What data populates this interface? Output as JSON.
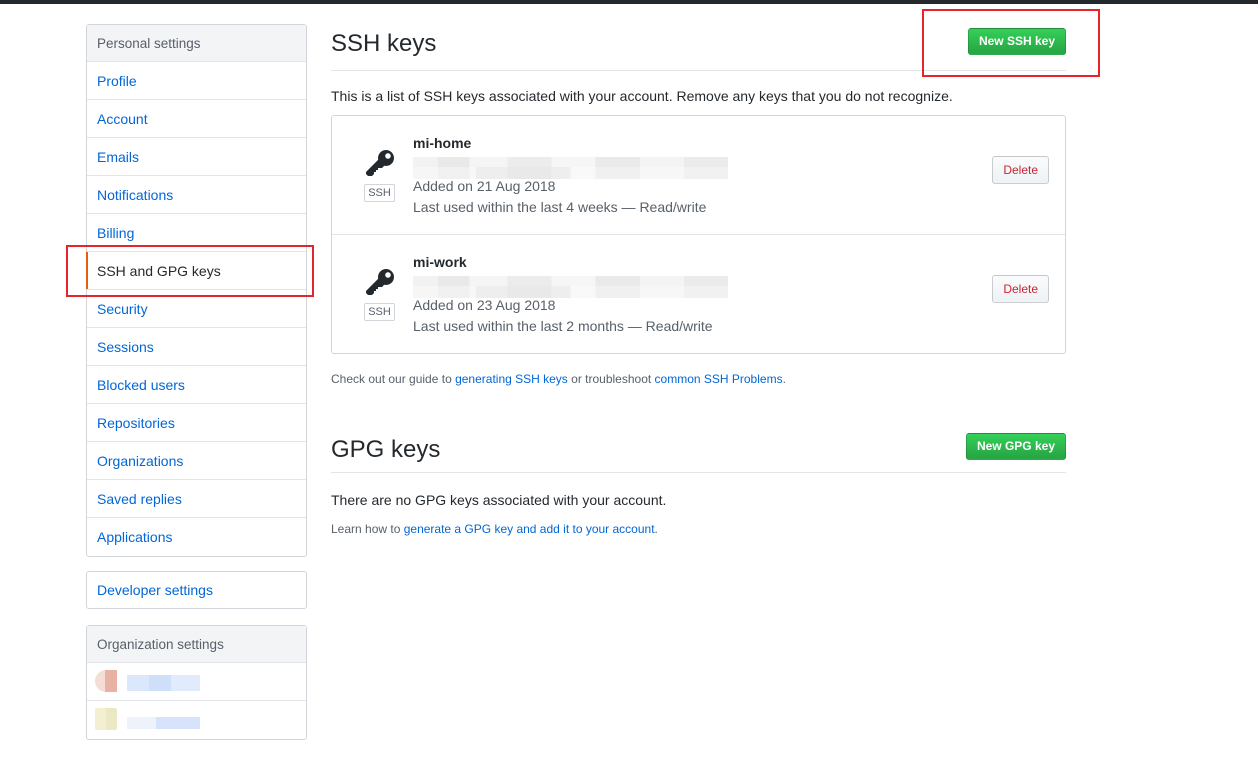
{
  "sidebar": {
    "personal_heading": "Personal settings",
    "items": [
      {
        "label": "Profile"
      },
      {
        "label": "Account"
      },
      {
        "label": "Emails"
      },
      {
        "label": "Notifications"
      },
      {
        "label": "Billing"
      },
      {
        "label": "SSH and GPG keys",
        "selected": true
      },
      {
        "label": "Security"
      },
      {
        "label": "Sessions"
      },
      {
        "label": "Blocked users"
      },
      {
        "label": "Repositories"
      },
      {
        "label": "Organizations"
      },
      {
        "label": "Saved replies"
      },
      {
        "label": "Applications"
      }
    ],
    "developer_settings": "Developer settings",
    "org_heading": "Organization settings"
  },
  "ssh": {
    "title": "SSH keys",
    "new_button": "New SSH key",
    "intro": "This is a list of SSH keys associated with your account. Remove any keys that you do not recognize.",
    "keys": [
      {
        "title": "mi-home",
        "badge": "SSH",
        "added": "Added on 21 Aug 2018",
        "last_used": "Last used within the last 4 weeks — Read/write",
        "delete_label": "Delete"
      },
      {
        "title": "mi-work",
        "badge": "SSH",
        "added": "Added on 23 Aug 2018",
        "last_used": "Last used within the last 2 months — Read/write",
        "delete_label": "Delete"
      }
    ],
    "help": {
      "prefix": "Check out our guide to ",
      "link1": "generating SSH keys",
      "middle": " or troubleshoot ",
      "link2": "common SSH Problems",
      "suffix": "."
    }
  },
  "gpg": {
    "title": "GPG keys",
    "new_button": "New GPG key",
    "empty": "There are no GPG keys associated with your account.",
    "help": {
      "prefix": "Learn how to ",
      "link": "generate a GPG key and add it to your account",
      "suffix": "."
    }
  },
  "colors": {
    "link": "#0366d6",
    "green": "#28a745",
    "danger": "#cb2431",
    "selected_indicator": "#e36209",
    "annotation": "#e5252b"
  }
}
